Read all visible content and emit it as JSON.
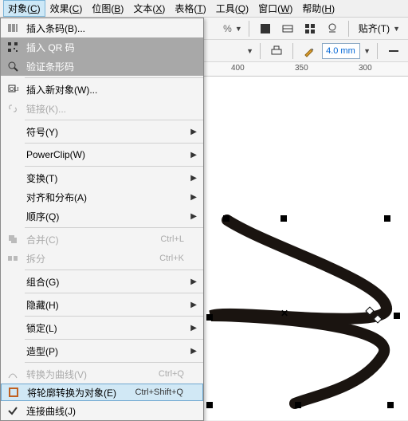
{
  "menubar": {
    "items": [
      {
        "label": "对象(C)",
        "accel": "C"
      },
      {
        "label": "效果(C)",
        "accel": "C"
      },
      {
        "label": "位图(B)",
        "accel": "B"
      },
      {
        "label": "文本(X)",
        "accel": "X"
      },
      {
        "label": "表格(T)",
        "accel": "T"
      },
      {
        "label": "工具(Q)",
        "accel": "Q"
      },
      {
        "label": "窗口(W)",
        "accel": "W"
      },
      {
        "label": "帮助(H)",
        "accel": "H"
      }
    ],
    "active_index": 0
  },
  "toolbar2": {
    "outline_width": "4.0 mm",
    "paste_label": "贴齐(T)"
  },
  "ruler": {
    "ticks": [
      {
        "label": "400",
        "pos": 290
      },
      {
        "label": "350",
        "pos": 370
      },
      {
        "label": "300",
        "pos": 450
      }
    ]
  },
  "dropdown": {
    "items": [
      {
        "label": "插入条码(B)...",
        "icon": "barcode",
        "type": "item"
      },
      {
        "label": "插入 QR 码",
        "icon": "qr",
        "type": "item",
        "state": "hover-dark"
      },
      {
        "label": "验证条形码",
        "icon": "validate",
        "type": "item",
        "state": "hover-dark"
      },
      {
        "type": "sep"
      },
      {
        "label": "插入新对象(W)...",
        "icon": "ole",
        "type": "item"
      },
      {
        "label": "链接(K)...",
        "icon": "link",
        "type": "item",
        "disabled": true
      },
      {
        "type": "sep"
      },
      {
        "label": "符号(Y)",
        "type": "submenu"
      },
      {
        "type": "sep"
      },
      {
        "label": "PowerClip(W)",
        "type": "submenu"
      },
      {
        "type": "sep"
      },
      {
        "label": "变换(T)",
        "type": "submenu"
      },
      {
        "label": "对齐和分布(A)",
        "type": "submenu"
      },
      {
        "label": "顺序(Q)",
        "type": "submenu"
      },
      {
        "type": "sep"
      },
      {
        "label": "合并(C)",
        "shortcut": "Ctrl+L",
        "icon": "combine",
        "type": "item",
        "disabled": true
      },
      {
        "label": "拆分",
        "shortcut": "Ctrl+K",
        "icon": "break",
        "type": "item",
        "disabled": true
      },
      {
        "type": "sep"
      },
      {
        "label": "组合(G)",
        "type": "submenu"
      },
      {
        "type": "sep"
      },
      {
        "label": "隐藏(H)",
        "type": "submenu"
      },
      {
        "type": "sep"
      },
      {
        "label": "锁定(L)",
        "type": "submenu"
      },
      {
        "type": "sep"
      },
      {
        "label": "造型(P)",
        "type": "submenu"
      },
      {
        "type": "sep"
      },
      {
        "label": "转换为曲线(V)",
        "shortcut": "Ctrl+Q",
        "icon": "curve",
        "type": "item",
        "disabled": true
      },
      {
        "label": "将轮廓转换为对象(E)",
        "shortcut": "Ctrl+Shift+Q",
        "icon": "outline",
        "type": "item",
        "state": "hover-light"
      },
      {
        "label": "连接曲线(J)",
        "icon": "check",
        "type": "item"
      }
    ]
  }
}
